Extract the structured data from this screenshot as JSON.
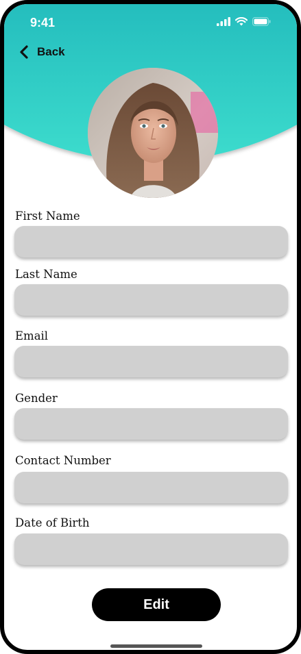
{
  "status_bar": {
    "time": "9:41",
    "icons": [
      "cellular-signal-icon",
      "wifi-icon",
      "battery-icon"
    ]
  },
  "nav": {
    "back_label": "Back",
    "back_icon": "chevron-left-icon"
  },
  "colors": {
    "header_top": "#1bb2b8",
    "header_bottom": "#3ddccd",
    "input_bg": "#d0d0d0",
    "button_bg": "#000000",
    "button_text": "#ffffff"
  },
  "form": {
    "fields": [
      {
        "label": "First Name",
        "value": "",
        "placeholder": ""
      },
      {
        "label": "Last Name",
        "value": "",
        "placeholder": ""
      },
      {
        "label": "Email",
        "value": "",
        "placeholder": ""
      },
      {
        "label": "Gender",
        "value": "",
        "placeholder": ""
      },
      {
        "label": "Contact Number",
        "value": "",
        "placeholder": ""
      },
      {
        "label": "Date of Birth",
        "value": "",
        "placeholder": ""
      }
    ]
  },
  "actions": {
    "edit_label": "Edit"
  }
}
